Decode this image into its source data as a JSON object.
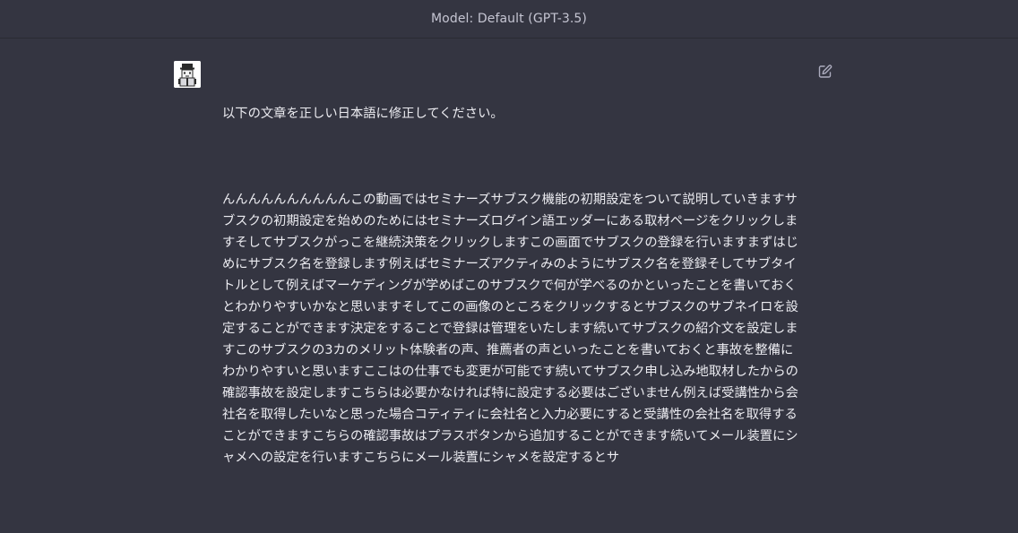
{
  "header": {
    "model_label": "Model: Default (GPT-3.5)"
  },
  "message": {
    "author": "user",
    "avatar_icon": "user-avatar-icon",
    "edit_icon": "edit-icon",
    "paragraphs": [
      "以下の文章を正しい日本語に修正してください。",
      "んんんんんんんんんんこの動画ではセミナーズサブスク機能の初期設定をついて説明していきますサブスクの初期設定を始めのためにはセミナーズログイン語エッダーにある取材ページをクリックしますそしてサブスクがっこを継続決策をクリックしますこの画面でサブスクの登録を行いますまずはじめにサブスク名を登録します例えばセミナーズアクティみのようにサブスク名を登録そしてサブタイトルとして例えばマーケディングが学めばこのサブスクで何が学べるのかといったことを書いておくとわかりやすいかなと思いますそしてこの画像のところをクリックするとサブスクのサブネイロを設定することができます決定をすることで登録は管理をいたします続いてサブスクの紹介文を設定しますこのサブスクの3カのメリット体験者の声、推薦者の声といったことを書いておくと事故を整備にわかりやすいと思いますここはの仕事でも変更が可能です続いてサブスク申し込み地取材したからの確認事故を設定しますこちらは必要かなければ特に設定する必要はございません例えば受講性から会社名を取得したいなと思った場合コティティに会社名と入力必要にすると受講性の会社名を取得することができますこちらの確認事故はプラスボタンから追加することができます続いてメール装置にシャメへの設定を行いますこちらにメール装置にシャメを設定するとサ"
    ]
  }
}
